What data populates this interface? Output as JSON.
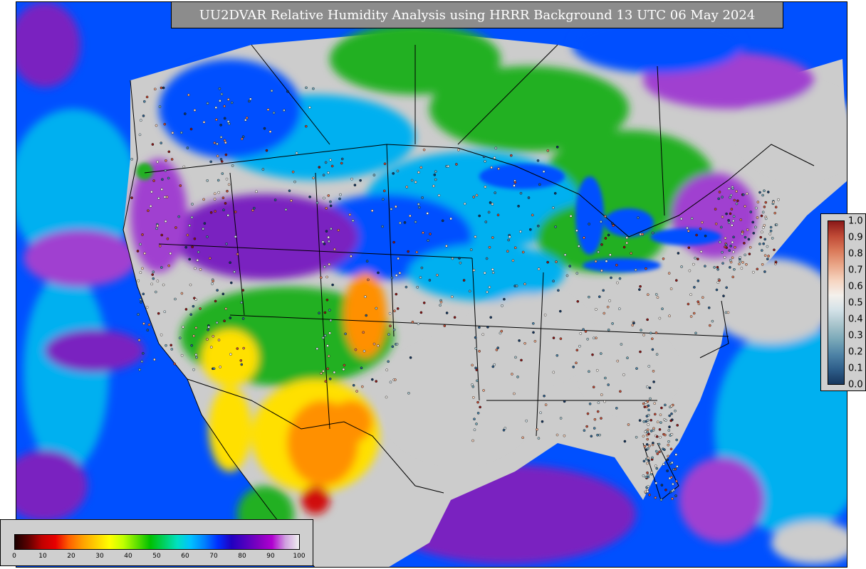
{
  "title": "UU2DVAR Relative Humidity Analysis using HRRR Background 13 UTC 06 May 2024",
  "rh_colorbar": {
    "ticks": [
      "0",
      "10",
      "20",
      "30",
      "40",
      "50",
      "60",
      "70",
      "80",
      "90",
      "100"
    ],
    "colors": [
      "#1a0000",
      "#600000",
      "#c00000",
      "#e80000",
      "#ff6000",
      "#ffa000",
      "#ffd000",
      "#ffff00",
      "#c0ff00",
      "#60e000",
      "#00c000",
      "#00d060",
      "#00e0c0",
      "#00c0ff",
      "#0080ff",
      "#0030ff",
      "#2000c0",
      "#5000c0",
      "#8000c0",
      "#b000d0",
      "#d0a0e0",
      "#f0f0f0"
    ]
  },
  "qc_colorbar": {
    "ticks": [
      "0.0",
      "0.1",
      "0.2",
      "0.3",
      "0.4",
      "0.5",
      "0.6",
      "0.7",
      "0.8",
      "0.9",
      "1.0"
    ],
    "colors": [
      "#17375e",
      "#2e5e8a",
      "#4e83a6",
      "#79a8b8",
      "#a8c4cc",
      "#d4e2e8",
      "#f4f0ec",
      "#f6d4c0",
      "#eaa88a",
      "#da7a5a",
      "#c04a36",
      "#8a1818"
    ]
  },
  "map_colors": {
    "land_gray": "#cccccc",
    "ocean_blue": "#0050ff",
    "ocean_cyan": "#00b0f0",
    "purple": "#7a20c0",
    "violet": "#a040d0",
    "green": "#20b020",
    "yellow": "#ffe000",
    "orange": "#ff9000",
    "red": "#d01010",
    "border": "#000000"
  }
}
